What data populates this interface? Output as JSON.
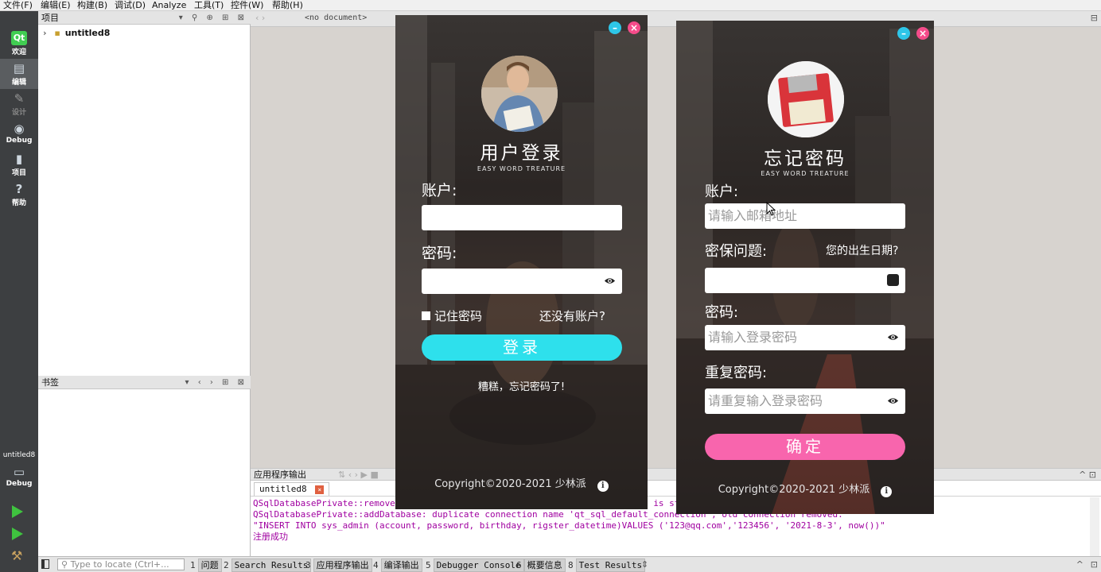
{
  "menu": [
    "文件(F)",
    "编辑(E)",
    "构建(B)",
    "调试(D)",
    "Analyze",
    "工具(T)",
    "控件(W)",
    "帮助(H)"
  ],
  "modes": [
    {
      "label": "欢迎",
      "icon": "qt-logo-icon"
    },
    {
      "label": "编辑",
      "icon": "edit-icon"
    },
    {
      "label": "设计",
      "icon": "design-icon"
    },
    {
      "label": "Debug",
      "icon": "debug-icon"
    },
    {
      "label": "项目",
      "icon": "project-icon"
    },
    {
      "label": "帮助",
      "icon": "help-icon"
    }
  ],
  "kit": {
    "name": "untitled8",
    "mode": "Debug"
  },
  "projects": {
    "header": "项目",
    "tree_item": "untitled8"
  },
  "bookmarks": {
    "header": "书签"
  },
  "editor": {
    "document": "<no document>"
  },
  "output": {
    "header": "应用程序输出",
    "tab": "untitled8",
    "lines": [
      "QSqlDatabasePrivate::removeDatabase: connection 'qt_sql_default_connection' is still in use, all queries will cease to work.",
      "QSqlDatabasePrivate::addDatabase: duplicate connection name 'qt_sql_default_connection', old connection removed.",
      "\"INSERT INTO sys_admin (account, password, birthday, rigster_datetime)VALUES ('123@qq.com','123456', '2021-8-3', now())\"",
      "注册成功"
    ]
  },
  "statusbar": {
    "locate_placeholder": "Type to locate (Ctrl+...",
    "tabs": [
      {
        "n": "1",
        "label": "问题"
      },
      {
        "n": "2",
        "label": "Search Results"
      },
      {
        "n": "3",
        "label": "应用程序输出"
      },
      {
        "n": "4",
        "label": "编译输出"
      },
      {
        "n": "5",
        "label": "Debugger Console"
      },
      {
        "n": "6",
        "label": "概要信息"
      },
      {
        "n": "8",
        "label": "Test Results"
      }
    ]
  },
  "login": {
    "title": "用户登录",
    "subtitle": "EASY WORD TREATURE",
    "account_label": "账户:",
    "password_label": "密码:",
    "remember": "记住密码",
    "no_account": "还没有账户?",
    "login_button": "登录",
    "forgot": "糟糕，忘记密码了!",
    "copyright": "Copyright©2020-2021 少林派",
    "account_value": "",
    "password_value": ""
  },
  "forgot": {
    "title": "忘记密码",
    "subtitle": "EASY WORD TREATURE",
    "account_label": "账户:",
    "account_placeholder": "请输入邮箱地址",
    "question_label": "密保问题:",
    "question": "您的出生日期?",
    "password_label": "密码:",
    "password_placeholder": "请输入登录密码",
    "repeat_label": "重复密码:",
    "repeat_placeholder": "请重复输入登录密码",
    "confirm_button": "确定",
    "copyright": "Copyright©2020-2021 少林派"
  },
  "colors": {
    "cyan": "#2ee0ec",
    "pink": "#f865ad",
    "modebar": "#3d3f41"
  }
}
